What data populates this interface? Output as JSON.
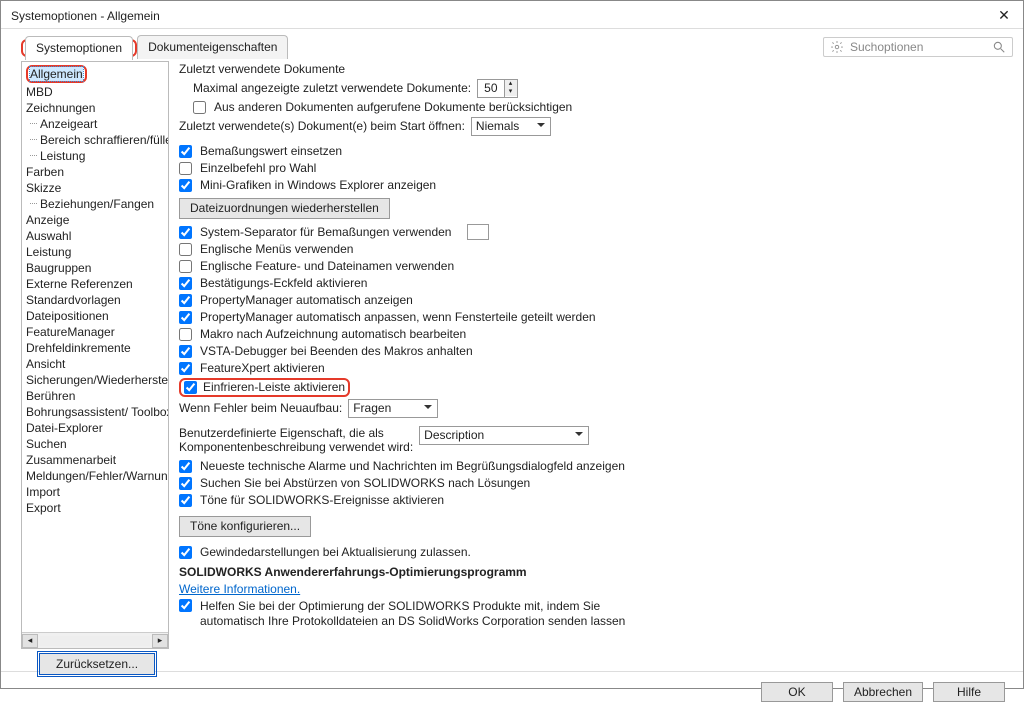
{
  "window": {
    "title": "Systemoptionen - Allgemein"
  },
  "tabs": {
    "system": "Systemoptionen",
    "document": "Dokumenteigenschaften"
  },
  "search": {
    "placeholder": "Suchoptionen"
  },
  "sidebar": {
    "items": [
      {
        "label": "Allgemein",
        "selected": true,
        "highlight": true
      },
      {
        "label": "MBD"
      },
      {
        "label": "Zeichnungen"
      },
      {
        "label": "Anzeigeart",
        "sub": true
      },
      {
        "label": "Bereich schraffieren/füllen",
        "sub": true
      },
      {
        "label": "Leistung",
        "sub": true
      },
      {
        "label": "Farben"
      },
      {
        "label": "Skizze"
      },
      {
        "label": "Beziehungen/Fangen",
        "sub": true
      },
      {
        "label": "Anzeige"
      },
      {
        "label": "Auswahl"
      },
      {
        "label": "Leistung"
      },
      {
        "label": "Baugruppen"
      },
      {
        "label": "Externe Referenzen"
      },
      {
        "label": "Standardvorlagen"
      },
      {
        "label": "Dateipositionen"
      },
      {
        "label": "FeatureManager"
      },
      {
        "label": "Drehfeldinkremente"
      },
      {
        "label": "Ansicht"
      },
      {
        "label": "Sicherungen/Wiederherstellen"
      },
      {
        "label": "Berühren"
      },
      {
        "label": "Bohrungsassistent/ Toolbox"
      },
      {
        "label": "Datei-Explorer"
      },
      {
        "label": "Suchen"
      },
      {
        "label": "Zusammenarbeit"
      },
      {
        "label": "Meldungen/Fehler/Warnungen"
      },
      {
        "label": "Import"
      },
      {
        "label": "Export"
      }
    ]
  },
  "content": {
    "recent_header": "Zuletzt verwendete Dokumente",
    "max_recent_label": "Maximal angezeigte zuletzt verwendete Dokumente:",
    "max_recent_value": "50",
    "include_other_docs": "Aus anderen Dokumenten aufgerufene Dokumente berücksichtigen",
    "open_on_start_label": "Zuletzt verwendete(s) Dokument(e) beim Start öffnen:",
    "open_on_start_value": "Niemals",
    "dim_insert": "Bemaßungswert einsetzen",
    "single_cmd": "Einzelbefehl pro Wahl",
    "mini_graphics": "Mini-Grafiken in Windows Explorer anzeigen",
    "restore_assoc_btn": "Dateizuordnungen wiederherstellen",
    "use_sys_sep": "System-Separator für Bemaßungen verwenden",
    "eng_menus": "Englische Menüs verwenden",
    "eng_features": "Englische Feature- und Dateinamen verwenden",
    "confirm_corner": "Bestätigungs-Eckfeld aktivieren",
    "pm_auto_show": "PropertyManager automatisch anzeigen",
    "pm_auto_size": "PropertyManager automatisch anpassen, wenn Fensterteile geteilt werden",
    "macro_after_rec": "Makro nach Aufzeichnung automatisch bearbeiten",
    "vsta_debug": "VSTA-Debugger bei Beenden des Makros anhalten",
    "featurexpert": "FeatureXpert aktivieren",
    "freeze_bar": "Einfrieren-Leiste aktivieren",
    "rebuild_err_label": "Wenn Fehler beim Neuaufbau:",
    "rebuild_err_value": "Fragen",
    "custom_prop_label_1": "Benutzerdefinierte Eigenschaft, die als",
    "custom_prop_label_2": "Komponentenbeschreibung verwendet wird:",
    "custom_prop_value": "Description",
    "show_alerts": "Neueste technische Alarme und Nachrichten im Begrüßungsdialogfeld anzeigen",
    "search_crash": "Suchen Sie bei Abstürzen von SOLIDWORKS nach Lösungen",
    "sounds_enable": "Töne für SOLIDWORKS-Ereignisse aktivieren",
    "configure_sounds_btn": "Töne konfigurieren...",
    "thread_updates": "Gewindedarstellungen bei Aktualisierung zulassen.",
    "cep_header": "SOLIDWORKS Anwendererfahrungs-Optimierungsprogramm",
    "more_info": "Weitere Informationen.",
    "cep_line1": "Helfen Sie bei der Optimierung der SOLIDWORKS Produkte mit, indem Sie",
    "cep_line2": "automatisch Ihre Protokolldateien an DS SolidWorks Corporation senden lassen"
  },
  "buttons": {
    "reset": "Zurücksetzen...",
    "ok": "OK",
    "cancel": "Abbrechen",
    "help": "Hilfe"
  }
}
